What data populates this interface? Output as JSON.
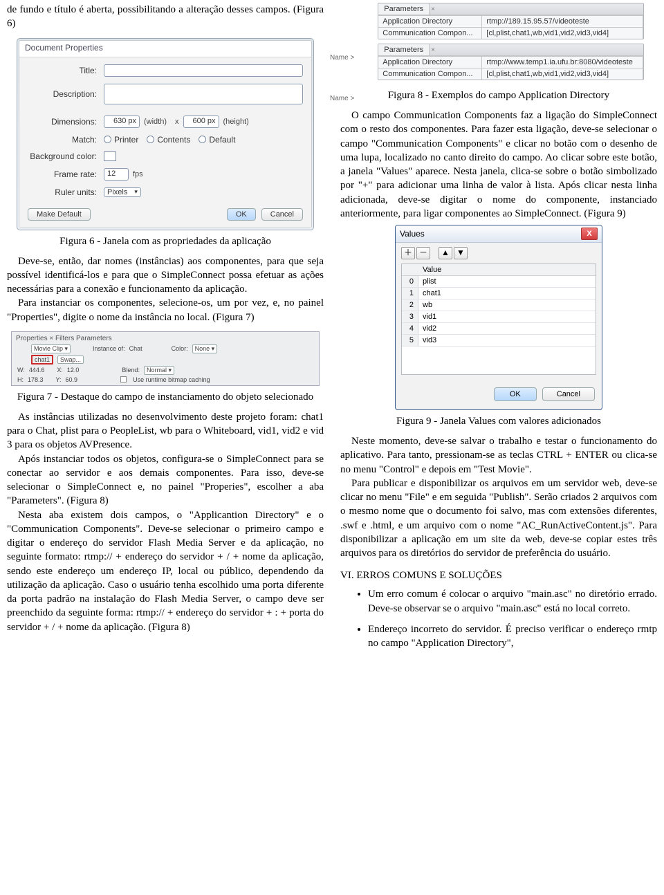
{
  "left": {
    "intro": "de fundo e título é aberta, possibilitando a alteração desses campos. (Figura 6)",
    "fig6": {
      "title": "Document Properties",
      "labels": {
        "title": "Title:",
        "description": "Description:",
        "dimensions": "Dimensions:",
        "match": "Match:",
        "bgcolor": "Background color:",
        "framerate": "Frame rate:",
        "ruler": "Ruler units:"
      },
      "dims": {
        "w": "630 px",
        "wlabel": "(width)",
        "x": "x",
        "h": "600 px",
        "hlabel": "(height)"
      },
      "match": {
        "printer": "Printer",
        "contents": "Contents",
        "default": "Default"
      },
      "framerate": {
        "value": "12",
        "unit": "fps"
      },
      "ruler_value": "Pixels",
      "buttons": {
        "makedefault": "Make Default",
        "ok": "OK",
        "cancel": "Cancel"
      }
    },
    "caption6": "Figura 6 - Janela com as propriedades da aplicação",
    "para_after6_a": "Deve-se, então, dar nomes (instâncias) aos componentes, para que seja possível identificá-los e para que o SimpleConnect possa efetuar as ações necessárias para a conexão e funcionamento da aplicação.",
    "para_after6_b": "Para instanciar os componentes, selecione-os, um por vez, e, no painel \"Properties\", digite o nome da instância no local. (Figura 7)",
    "fig7": {
      "tabs": "Properties ×   Filters   Parameters",
      "movieclip": "Movie Clip",
      "instanceof": "Instance of:",
      "chat": "Chat",
      "inst": "chat1",
      "swap": "Swap...",
      "color": "Color:",
      "none": "None",
      "blend": "Blend:",
      "normal": "Normal",
      "w": "W:",
      "wv": "444.6",
      "x": "X:",
      "xv": "12.0",
      "h": "H:",
      "hv": "178.3",
      "y": "Y:",
      "yv": "60.9",
      "cache": "Use runtime bitmap caching"
    },
    "caption7": "Figura 7 - Destaque do campo de instanciamento do objeto selecionado",
    "para_after7_a": "As instâncias utilizadas no desenvolvimento deste projeto foram: chat1 para o Chat, plist para o PeopleList, wb para o Whiteboard, vid1, vid2 e vid 3 para os objetos AVPresence.",
    "para_after7_b": "Após instanciar todos os objetos, configura-se o SimpleConnect para se conectar ao servidor e aos demais componentes. Para isso, deve-se selecionar o SimpleConnect e, no painel \"Properies\", escolher a aba \"Parameters\". (Figura 8)",
    "para_after7_c": "Nesta aba existem dois campos, o \"Applicantion Directory\" e o \"Communication Components\". Deve-se selecionar o primeiro campo e digitar o endereço do servidor Flash Media Server e da aplicação, no seguinte formato: rtmp:// + endereço do servidor + / + nome da aplicação, sendo este endereço um endereço IP, local ou público, dependendo da utilização da aplicação. Caso o usuário tenha escolhido uma porta diferente da porta padrão na instalação do Flash Media Server, o campo deve ser preenchido da seguinte forma: rtmp:// + endereço do servidor + : + porta do servidor + / + nome da aplicação. (Figura 8)"
  },
  "right": {
    "fig8": {
      "tab_label": "Parameters",
      "tab_x": "×",
      "name_prefix": "Name >",
      "rows_a": {
        "appdir_l": "Application Directory",
        "appdir_v": "rtmp://189.15.95.57/videoteste",
        "comm_l": "Communication Compon...",
        "comm_v": "[cl,plist,chat1,wb,vid1,vid2,vid3,vid4]"
      },
      "rows_b": {
        "appdir_l": "Application Directory",
        "appdir_v": "rtmp://www.temp1.ia.ufu.br:8080/videoteste",
        "comm_l": "Communication Compon...",
        "comm_v": "[cl,plist,chat1,wb,vid1,vid2,vid3,vid4]"
      }
    },
    "caption8": "Figura 8 - Exemplos do campo Application Directory",
    "para8": "O campo Communication Components faz a ligação do SimpleConnect com o resto dos componentes. Para fazer esta ligação, deve-se selecionar o campo \"Communication Components\" e clicar no botão com o desenho de uma lupa, localizado no canto direito do campo. Ao clicar sobre este botão, a janela \"Values\" aparece. Nesta janela, clica-se sobre o botão simbolizado por \"+\" para adicionar uma linha de valor à lista. Após clicar nesta linha adicionada, deve-se digitar o nome do componente, instanciado anteriormente, para ligar componentes ao SimpleConnect. (Figura 9)",
    "fig9": {
      "title": "Values",
      "plus": "＋",
      "minus": "－",
      "up": "▲",
      "down": "▼",
      "header": "Value",
      "rows": [
        {
          "idx": "0",
          "val": "plist"
        },
        {
          "idx": "1",
          "val": "chat1"
        },
        {
          "idx": "2",
          "val": "wb"
        },
        {
          "idx": "3",
          "val": "vid1"
        },
        {
          "idx": "4",
          "val": "vid2"
        },
        {
          "idx": "5",
          "val": "vid3"
        }
      ],
      "ok": "OK",
      "cancel": "Cancel",
      "close": "X"
    },
    "caption9": "Figura 9 - Janela Values com valores adicionados",
    "para9a": "Neste momento, deve-se salvar o trabalho e testar o funcionamento do aplicativo. Para tanto, pressionam-se as teclas CTRL + ENTER ou clica-se no menu \"Control\" e depois em \"Test Movie\".",
    "para9b": "Para publicar e disponibilizar os arquivos em um servidor web, deve-se clicar no menu \"File\" e em seguida \"Publish\". Serão criados 2 arquivos com o mesmo nome que o documento foi salvo, mas com extensões diferentes, .swf e .html, e um arquivo com o nome \"AC_RunActiveContent.js\". Para disponibilizar a aplicação em um site da web, deve-se copiar estes três arquivos para os diretórios do servidor de preferência do usuário.",
    "section6": "VI. ERROS COMUNS E SOLUÇÕES",
    "bul1": "Um erro comum é colocar o arquivo \"main.asc\" no diretório errado. Deve-se observar se o arquivo \"main.asc\" está no local correto.",
    "bul2": "Endereço incorreto do servidor. É preciso verificar o endereço rmtp no campo \"Application Directory\","
  }
}
